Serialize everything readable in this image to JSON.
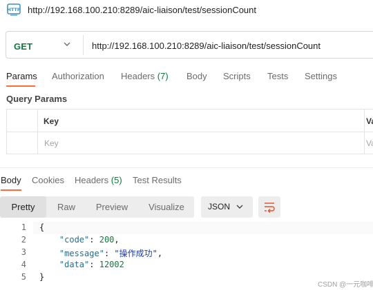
{
  "title": {
    "icon": "http-icon",
    "url": "http://192.168.100.210:8289/aic-liaison/test/sessionCount"
  },
  "request": {
    "method": "GET",
    "url": "http://192.168.100.210:8289/aic-liaison/test/sessionCount"
  },
  "request_tabs": [
    {
      "label": "Params",
      "active": true
    },
    {
      "label": "Authorization"
    },
    {
      "label": "Headers",
      "count": "(7)"
    },
    {
      "label": "Body"
    },
    {
      "label": "Scripts"
    },
    {
      "label": "Tests"
    },
    {
      "label": "Settings"
    }
  ],
  "query_params": {
    "title": "Query Params",
    "columns": [
      "Key",
      "Va"
    ],
    "placeholders": [
      "Key",
      "Va"
    ]
  },
  "response_tabs": [
    {
      "label": "Body",
      "active": true
    },
    {
      "label": "Cookies"
    },
    {
      "label": "Headers",
      "count": "(5)"
    },
    {
      "label": "Test Results"
    }
  ],
  "view_modes": [
    "Pretty",
    "Raw",
    "Preview",
    "Visualize"
  ],
  "active_view": "Pretty",
  "format": "JSON",
  "code": {
    "line_numbers": [
      "1",
      "2",
      "3",
      "4",
      "5"
    ],
    "brace_open": "{",
    "brace_close": "}",
    "code_key": "\"code\"",
    "code_value": "200",
    "message_key": "\"message\"",
    "message_value": "\"操作成功\"",
    "data_key": "\"data\"",
    "data_value": "12002",
    "sep": ": ",
    "comma": ","
  },
  "watermark": "CSDN @一元咖啡",
  "colors": {
    "accent": "#ff6c37",
    "method_get": "#0c7b3e",
    "json_string": "#1a3ab0",
    "json_key": "#1f6f8f"
  }
}
